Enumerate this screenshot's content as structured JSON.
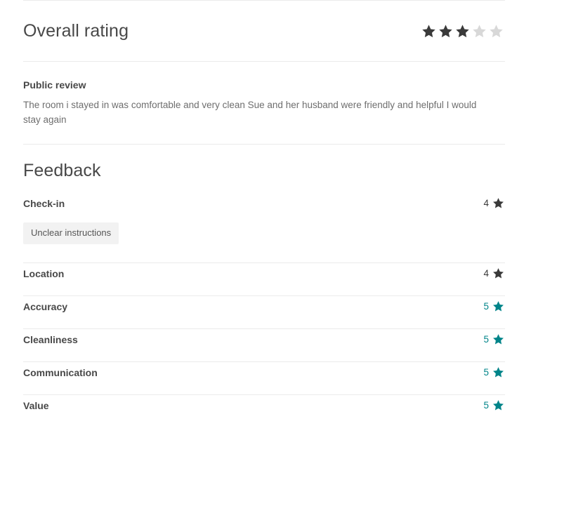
{
  "overall": {
    "title": "Overall rating",
    "rating": 3,
    "max_rating": 5,
    "filled_color": "#3A3A3A",
    "empty_color": "#D8D8D8"
  },
  "public_review": {
    "label": "Public review",
    "text": "The room i stayed in was comfortable and very clean Sue and her husband were friendly and helpful I would stay again"
  },
  "feedback": {
    "title": "Feedback",
    "teal_color": "#008489",
    "dark_color": "#3A3A3A",
    "categories": [
      {
        "name": "Check-in",
        "score": "4",
        "star_color": "#3A3A3A",
        "tags": [
          "Unclear instructions"
        ]
      },
      {
        "name": "Location",
        "score": "4",
        "star_color": "#3A3A3A",
        "tags": []
      },
      {
        "name": "Accuracy",
        "score": "5",
        "star_color": "#008489",
        "tags": []
      },
      {
        "name": "Cleanliness",
        "score": "5",
        "star_color": "#008489",
        "tags": []
      },
      {
        "name": "Communication",
        "score": "5",
        "star_color": "#008489",
        "tags": []
      },
      {
        "name": "Value",
        "score": "5",
        "star_color": "#008489",
        "tags": []
      }
    ]
  }
}
